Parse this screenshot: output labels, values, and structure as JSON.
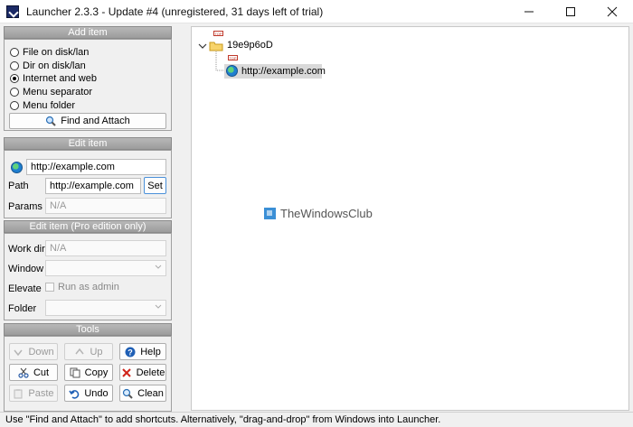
{
  "window": {
    "title": "Launcher 2.3.3 - Update #4 (unregistered, 31 days left of trial)",
    "controls": {
      "minimize": "minimize",
      "maximize": "maximize",
      "close": "close"
    }
  },
  "add_item": {
    "header": "Add item",
    "options": [
      {
        "label": "File on disk/lan",
        "checked": false
      },
      {
        "label": "Dir on disk/lan",
        "checked": false
      },
      {
        "label": "Internet and web",
        "checked": true
      },
      {
        "label": "Menu separator",
        "checked": false
      },
      {
        "label": "Menu folder",
        "checked": false
      }
    ],
    "find_attach_label": "Find and Attach"
  },
  "edit_item": {
    "header": "Edit item",
    "name_value": "http://example.com",
    "path_label": "Path",
    "path_value": "http://example.com",
    "set_label": "Set",
    "params_label": "Params",
    "params_placeholder": "N/A"
  },
  "edit_item_pro": {
    "header": "Edit item (Pro edition only)",
    "workdir_label": "Work dir",
    "workdir_placeholder": "N/A",
    "window_label": "Window",
    "window_value": "",
    "elevate_label": "Elevate",
    "run_as_admin_label": "Run as admin",
    "folder_label": "Folder",
    "folder_value": ""
  },
  "tools": {
    "header": "Tools",
    "down": "Down",
    "up": "Up",
    "help": "Help",
    "cut": "Cut",
    "copy": "Copy",
    "delete": "Delete",
    "paste": "Paste",
    "undo": "Undo",
    "clean": "Clean"
  },
  "tree": {
    "root_tag": "TOP",
    "folder_name": "19e9p6oD",
    "child_tag": "TOP",
    "item_label": "http://example.com"
  },
  "watermark": {
    "text": "TheWindowsClub"
  },
  "status": {
    "text": "Use \"Find and Attach\" to add shortcuts. Alternatively, \"drag-and-drop\" from Windows into Launcher."
  },
  "colors": {
    "section_header": "#a8a8a8",
    "selection": "#d9d9d9",
    "accent": "#1f7fd0"
  }
}
